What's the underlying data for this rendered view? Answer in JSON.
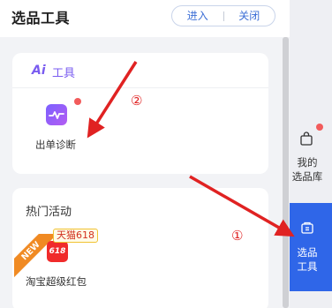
{
  "header": {
    "title": "选品工具",
    "enter_label": "进入",
    "close_label": "关闭"
  },
  "ai_card": {
    "logo_text": "Ai",
    "title": "工具",
    "tool_label": "出单诊断"
  },
  "activity_card": {
    "title": "热门活动",
    "badge_new": "NEW",
    "tag": "天猫618",
    "icon_text": "618",
    "item_label": "淘宝超级红包"
  },
  "rail": {
    "library_label_line1": "我的",
    "library_label_line2": "选品库",
    "tool_label_line1": "选品",
    "tool_label_line2": "工具"
  },
  "annotations": {
    "marker_1": "①",
    "marker_2": "②"
  },
  "colors": {
    "accent_blue": "#2f66e8",
    "ai_purple": "#7a5cf0",
    "annotation_red": "#e02222",
    "badge_orange": "#f08a23"
  }
}
